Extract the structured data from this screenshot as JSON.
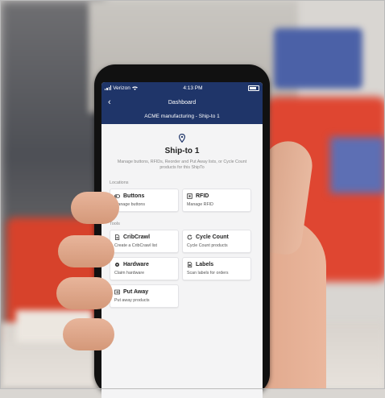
{
  "status": {
    "carrier": "Verizon",
    "time": "4:13 PM"
  },
  "nav": {
    "back_label": "‹",
    "title": "Dashboard",
    "subtitle": "ACME manufacturing - Ship-to 1"
  },
  "page": {
    "title": "Ship-to 1",
    "description": "Manage buttons, RFIDs, Reorder and Put Away lists, or Cycle Count products for this ShipTo"
  },
  "sections": {
    "locations": {
      "label": "Locations",
      "cards": [
        {
          "title": "Buttons",
          "subtitle": "Manage buttons",
          "icon": "toggle-icon"
        },
        {
          "title": "RFID",
          "subtitle": "Manage RFID",
          "icon": "rfid-icon"
        }
      ]
    },
    "tools": {
      "label": "Tools",
      "cards": [
        {
          "title": "CribCrawl",
          "subtitle": "Create a CribCrawl list",
          "icon": "document-icon"
        },
        {
          "title": "Cycle Count",
          "subtitle": "Cycle Count products",
          "icon": "refresh-icon"
        },
        {
          "title": "Hardware",
          "subtitle": "Claim hardware",
          "icon": "gear-icon"
        },
        {
          "title": "Labels",
          "subtitle": "Scan labels for orders",
          "icon": "label-icon"
        },
        {
          "title": "Put Away",
          "subtitle": "Put away products",
          "icon": "put-away-icon"
        }
      ]
    }
  },
  "colors": {
    "header": "#1f3569",
    "background": "#f4f4f5",
    "card": "#ffffff"
  }
}
